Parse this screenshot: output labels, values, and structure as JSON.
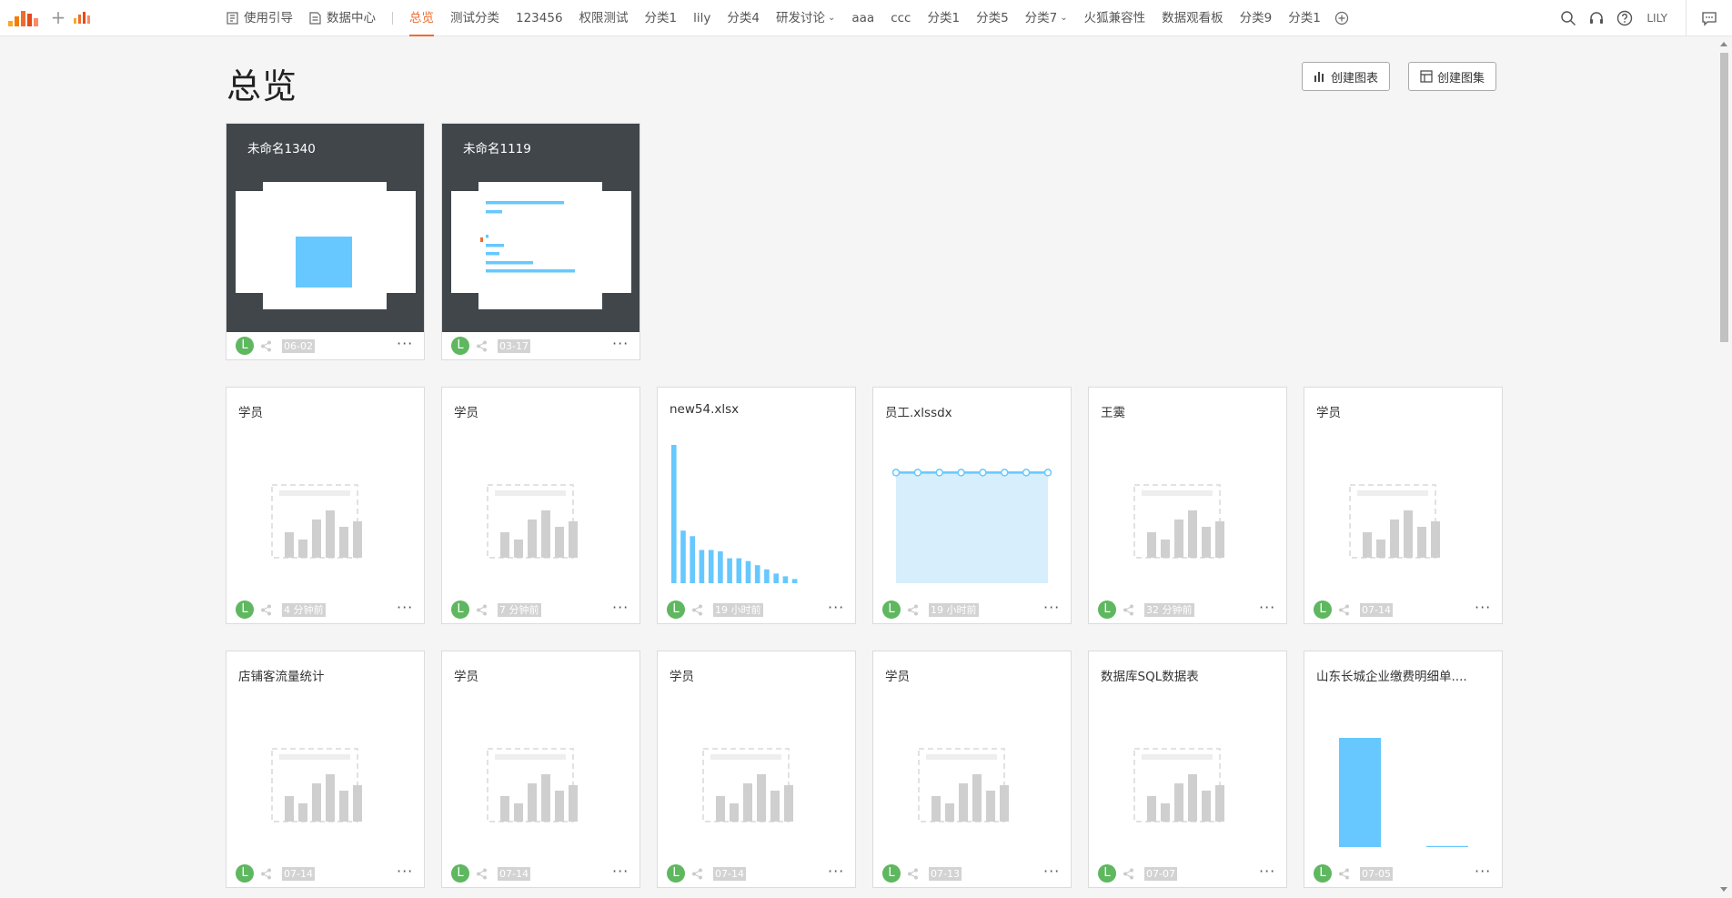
{
  "nav": {
    "items": [
      {
        "label": "使用引导",
        "icon": "guide-icon"
      },
      {
        "label": "数据中心",
        "icon": "document-icon"
      },
      {
        "label": "总览",
        "active": true
      },
      {
        "label": "测试分类"
      },
      {
        "label": "123456"
      },
      {
        "label": "权限测试"
      },
      {
        "label": "分类1"
      },
      {
        "label": "lily"
      },
      {
        "label": "分类4"
      },
      {
        "label": "研发讨论",
        "dropdown": true
      },
      {
        "label": "aaa"
      },
      {
        "label": "ccc"
      },
      {
        "label": "分类1"
      },
      {
        "label": "分类5"
      },
      {
        "label": "分类7",
        "dropdown": true
      },
      {
        "label": "火狐兼容性"
      },
      {
        "label": "数据观看板"
      },
      {
        "label": "分类9"
      },
      {
        "label": "分类1"
      }
    ],
    "user": "LILY"
  },
  "header": {
    "title": "总览",
    "create_chart": "创建图表",
    "create_atlas": "创建图集"
  },
  "colors": {
    "accent": "#ef6c2f",
    "chart_blue": "#66c8ff",
    "avatar_green": "#5fb760",
    "dashboard_bg": "#40464a"
  },
  "dashboards": [
    {
      "title": "未命名1340",
      "date": "06-02",
      "avatar": "L"
    },
    {
      "title": "未命名1119",
      "date": "03-17",
      "avatar": "L"
    }
  ],
  "cards": [
    {
      "title": "学员",
      "date": "4 分钟前",
      "avatar": "L",
      "preview": "placeholder"
    },
    {
      "title": "学员",
      "date": "7 分钟前",
      "avatar": "L",
      "preview": "placeholder"
    },
    {
      "title": "new54.xlsx",
      "date": "19 小时前",
      "avatar": "L",
      "preview": "bar"
    },
    {
      "title": "员工.xlssdx",
      "date": "19 小时前",
      "avatar": "L",
      "preview": "area"
    },
    {
      "title": "王霙",
      "date": "32 分钟前",
      "avatar": "L",
      "preview": "placeholder"
    },
    {
      "title": "学员",
      "date": "07-14",
      "avatar": "L",
      "preview": "placeholder"
    },
    {
      "title": "店铺客流量统计",
      "date": "07-14",
      "avatar": "L",
      "preview": "placeholder"
    },
    {
      "title": "学员",
      "date": "07-14",
      "avatar": "L",
      "preview": "placeholder"
    },
    {
      "title": "学员",
      "date": "07-14",
      "avatar": "L",
      "preview": "placeholder"
    },
    {
      "title": "学员",
      "date": "07-13",
      "avatar": "L",
      "preview": "placeholder"
    },
    {
      "title": "数据库SQL数据表",
      "date": "07-07",
      "avatar": "L",
      "preview": "placeholder"
    },
    {
      "title": "山东长城企业缴费明细单....",
      "date": "07-05",
      "avatar": "L",
      "preview": "bar2"
    }
  ],
  "chart_data": [
    {
      "type": "bar",
      "values": [
        100,
        38,
        34,
        24,
        24,
        23,
        18,
        18,
        16,
        13,
        10,
        7,
        5,
        3
      ],
      "ylim": [
        0,
        100
      ]
    },
    {
      "type": "area",
      "values": [
        80,
        80,
        80,
        80,
        80,
        80,
        80,
        80
      ],
      "ylim": [
        0,
        100
      ]
    },
    {
      "type": "bar",
      "values": [
        100,
        1
      ],
      "ylim": [
        0,
        100
      ]
    }
  ]
}
